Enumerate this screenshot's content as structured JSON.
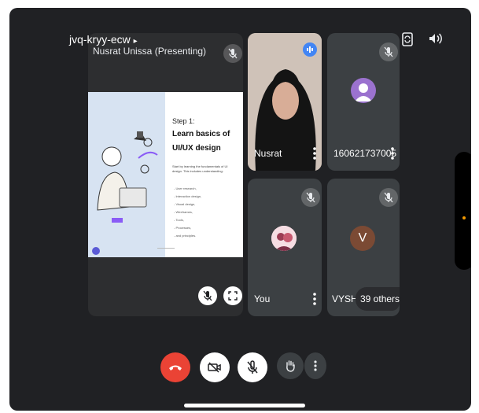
{
  "meeting": {
    "code": "jvq-kryy-ecw"
  },
  "presenter": {
    "label": "Nusrat Unissa (Presenting)"
  },
  "slide": {
    "step": "Step 1:",
    "title_line1": "Learn basics of",
    "title_line2": "UI/UX design",
    "body": "Start by learning the fundamentals of UI design. This includes understanding:",
    "bullets": [
      "- User research,",
      "- Interaction design,",
      "- Visual design,",
      "- Wireframes,",
      "- Tools,",
      "- Processes,",
      "- and principles."
    ]
  },
  "participants": [
    {
      "name": "Nusrat"
    },
    {
      "name": "160621737005"
    },
    {
      "name": "You"
    },
    {
      "name": "VYSHN",
      "initial": "V",
      "others": "39 others"
    }
  ],
  "colors": {
    "background": "#202124",
    "tile": "#3c4043",
    "end_call": "#ea4335",
    "speaking": "#4285f4",
    "avatar_purple": "#9b72cf",
    "avatar_brown": "#7b4a34"
  }
}
